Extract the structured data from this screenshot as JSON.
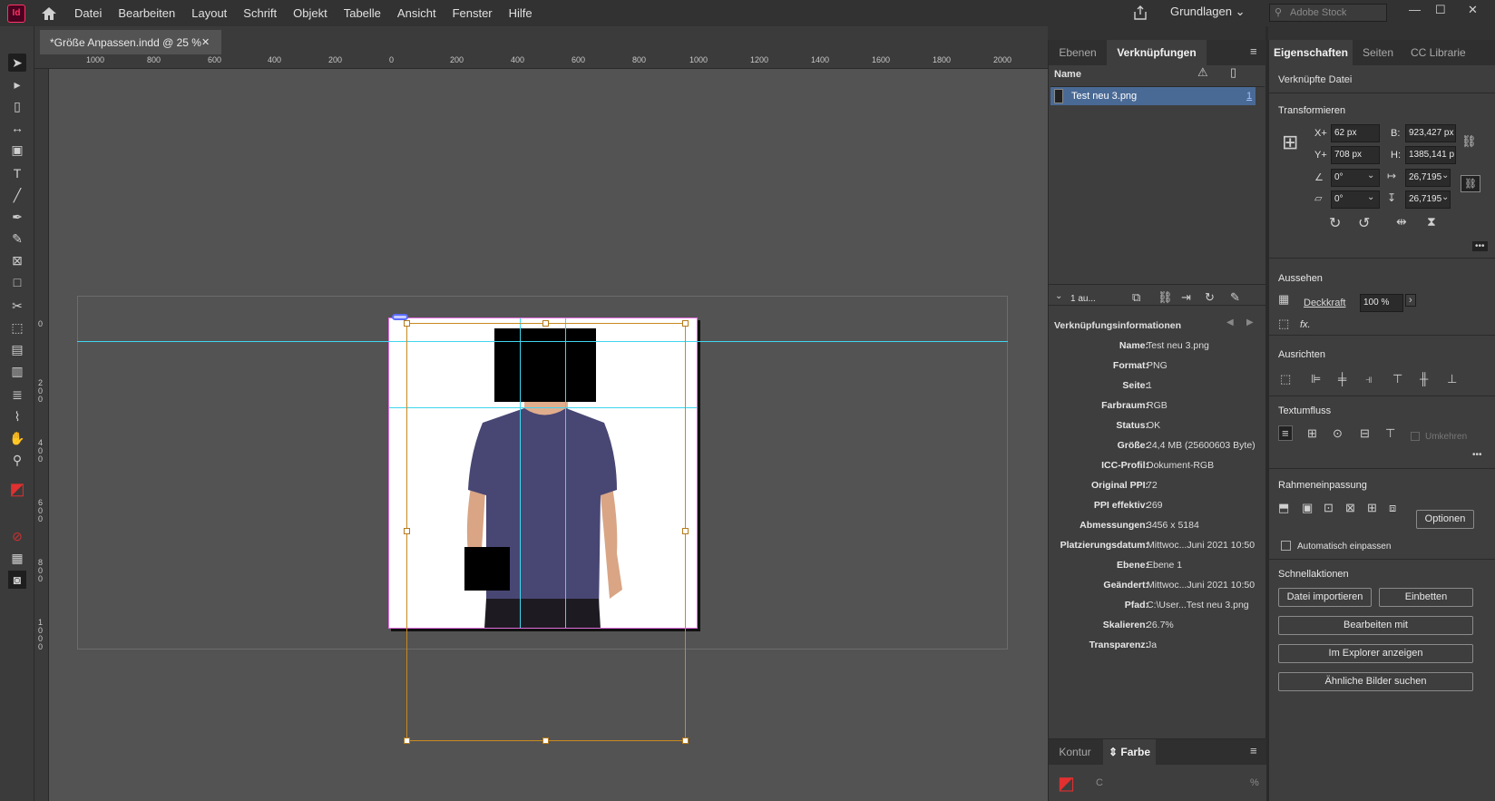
{
  "app": {
    "logo": "Id",
    "menu": [
      "Datei",
      "Bearbeiten",
      "Layout",
      "Schrift",
      "Objekt",
      "Tabelle",
      "Ansicht",
      "Fenster",
      "Hilfe"
    ],
    "workspace": "Grundlagen",
    "stock_placeholder": "Adobe Stock"
  },
  "document_tab": {
    "title": "*Größe Anpassen.indd @ 25 %",
    "close": "✕"
  },
  "ruler": {
    "h_labels": [
      "1000",
      "800",
      "600",
      "400",
      "200",
      "0",
      "200",
      "400",
      "600",
      "800",
      "1000",
      "1200",
      "1400",
      "1600",
      "1800",
      "2000"
    ],
    "v_labels": [
      "0",
      "200",
      "400",
      "600",
      "800",
      "1000"
    ]
  },
  "links_panel": {
    "tabs": [
      "Ebenen",
      "Verknüpfungen"
    ],
    "column_name": "Name",
    "link": {
      "name": "Test neu 3.png",
      "page": "1"
    },
    "footer_label": "1 au...",
    "info_title": "Verknüpfungsinformationen",
    "info": [
      {
        "label": "Name:",
        "value": "Test neu 3.png"
      },
      {
        "label": "Format:",
        "value": "PNG"
      },
      {
        "label": "Seite:",
        "value": "1"
      },
      {
        "label": "Farbraum:",
        "value": "RGB"
      },
      {
        "label": "Status:",
        "value": "OK"
      },
      {
        "label": "Größe:",
        "value": "24,4 MB (25600603 Byte)"
      },
      {
        "label": "ICC-Profil:",
        "value": "Dokument-RGB"
      },
      {
        "label": "Original PPI:",
        "value": "72"
      },
      {
        "label": "PPI effektiv:",
        "value": "269"
      },
      {
        "label": "Abmessungen:",
        "value": "3456 x 5184"
      },
      {
        "label": "Platzierungsdatum:",
        "value": "Mittwoc...Juni 2021 10:50"
      },
      {
        "label": "Ebene:",
        "value": "Ebene 1"
      },
      {
        "label": "Geändert:",
        "value": "Mittwoc...Juni 2021 10:50"
      },
      {
        "label": "Pfad:",
        "value": "C:\\User...Test neu 3.png"
      },
      {
        "label": "Skalieren:",
        "value": "26.7%"
      },
      {
        "label": "Transparenz:",
        "value": "Ja"
      }
    ],
    "bottom_tabs": [
      "Kontur",
      "Farbe"
    ],
    "color_channel": "C",
    "percent": "%"
  },
  "properties_panel": {
    "tabs": [
      "Eigenschaften",
      "Seiten",
      "CC Librarie"
    ],
    "object_type": "Verknüpfte Datei",
    "transform": {
      "title": "Transformieren",
      "x_label": "X+",
      "x": "62 px",
      "y_label": "Y+",
      "y": "708 px",
      "w_label": "B:",
      "w": "923,427 px",
      "h_label": "H:",
      "h": "1385,141 p",
      "rotate": "0°",
      "shear": "0°",
      "scale_x": "26,7195",
      "scale_y": "26,7195"
    },
    "appearance": {
      "title": "Aussehen",
      "opacity_label": "Deckkraft",
      "opacity": "100 %",
      "fx": "fx."
    },
    "align": {
      "title": "Ausrichten"
    },
    "textwrap": {
      "title": "Textumfluss",
      "invert": "Umkehren"
    },
    "fitting": {
      "title": "Rahmeneinpassung",
      "options_button": "Optionen",
      "auto_fit": "Automatisch einpassen"
    },
    "quick_actions": {
      "title": "Schnellaktionen",
      "buttons": [
        "Datei importieren",
        "Einbetten",
        "Bearbeiten mit",
        "Im Explorer anzeigen",
        "Ähnliche Bilder suchen"
      ]
    },
    "more": "•••"
  }
}
